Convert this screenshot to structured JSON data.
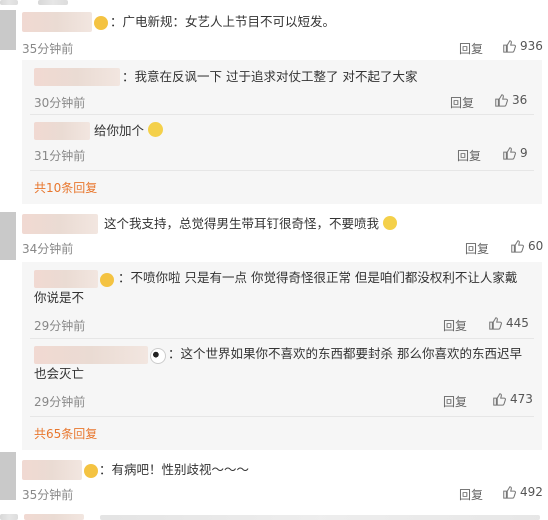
{
  "top_partial": {
    "text": "……"
  },
  "comments": [
    {
      "text": "：广电新规：女艺人上节目不可以短发。",
      "time": "35分钟前",
      "reply_label": "回复",
      "likes": "936"
    },
    {
      "text": "：不喷你啦 只是有一点 你觉得奇怪很正常 但是咱们都没权利不让人家戴 你说是不",
      "time": "29分钟前"
    }
  ],
  "replies_group_1": [
    {
      "text": "：我意在反讽一下 过于追求对仗工整了 对不起了大家",
      "time": "30分钟前",
      "reply_label": "回复",
      "likes": "36"
    },
    {
      "text": "给你加个",
      "time": "31分钟前",
      "reply_label": "回复",
      "likes": "9"
    }
  ],
  "more_1": "共10条回复",
  "comment_2": {
    "text": "这个我支持，总觉得男生带耳钉很奇怪，不要喷我",
    "time": "34分钟前",
    "reply_label": "回复",
    "likes": "60"
  },
  "replies_group_2": [
    {
      "text": "：不喷你啦 只是有一点 你觉得奇怪很正常 但是咱们都没权利不让人家戴 你说是不",
      "time": "29分钟前",
      "reply_label": "回复",
      "likes": "445"
    },
    {
      "text": "：这个世界如果你不喜欢的东西都要封杀 那么你喜欢的东西迟早也会灭亡",
      "time": "29分钟前",
      "reply_label": "回复",
      "likes": "473"
    }
  ],
  "more_2": "共65条回复",
  "comment_3": {
    "text": "：有病吧！性别歧视～～～",
    "time": "35分钟前",
    "reply_label": "回复",
    "likes": "492"
  }
}
